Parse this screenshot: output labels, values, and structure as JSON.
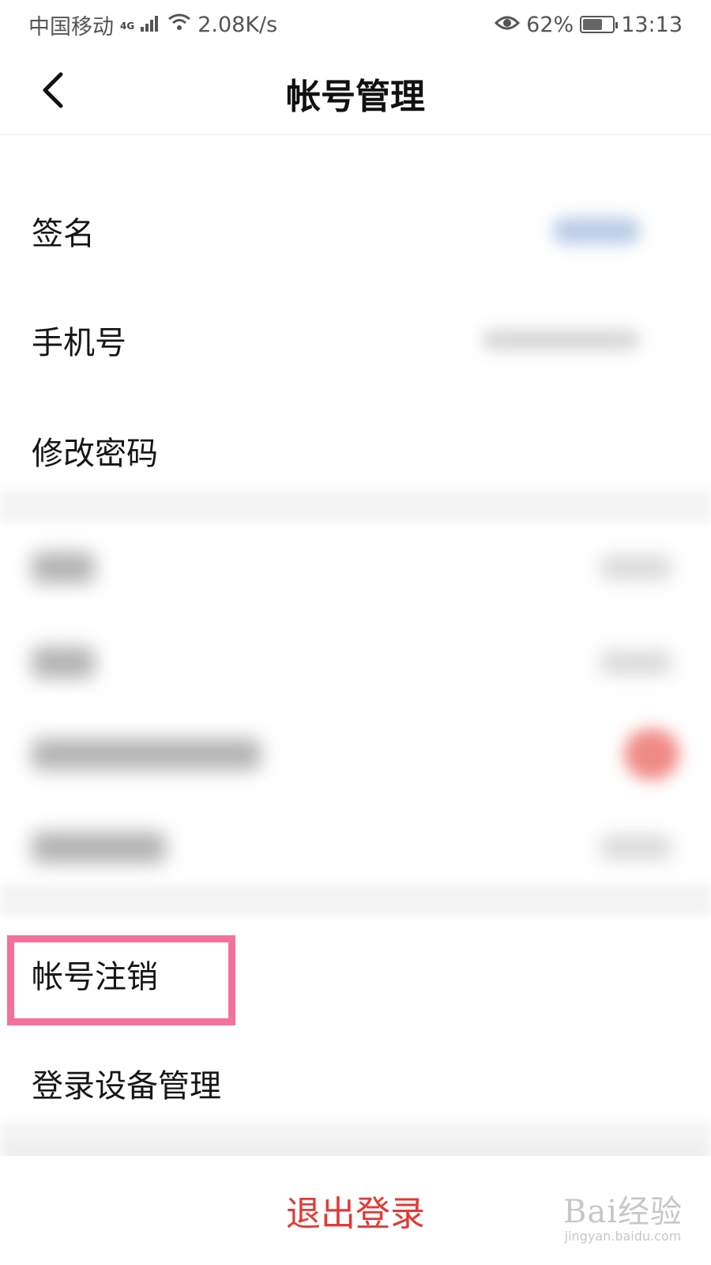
{
  "status_bar": {
    "carrier": "中国移动",
    "network_type": "4G",
    "speed": "2.08K/s",
    "battery": "62%",
    "time": "13:13"
  },
  "header": {
    "title": "帐号管理"
  },
  "rows": [
    {
      "label": "签名"
    },
    {
      "label": "手机号"
    },
    {
      "label": "修改密码"
    },
    {
      "label": "帐号注销"
    },
    {
      "label": "登录设备管理"
    }
  ],
  "footer": {
    "logout_label": "退出登录"
  },
  "watermark": {
    "logo_text": "Bai经验",
    "url": "jingyan.baidu.com"
  },
  "colors": {
    "highlight": "#f4729a",
    "logout": "#e53935",
    "blurred_value_blue": "#b9cde6",
    "blurred_toggle_red": "#f08a84"
  }
}
